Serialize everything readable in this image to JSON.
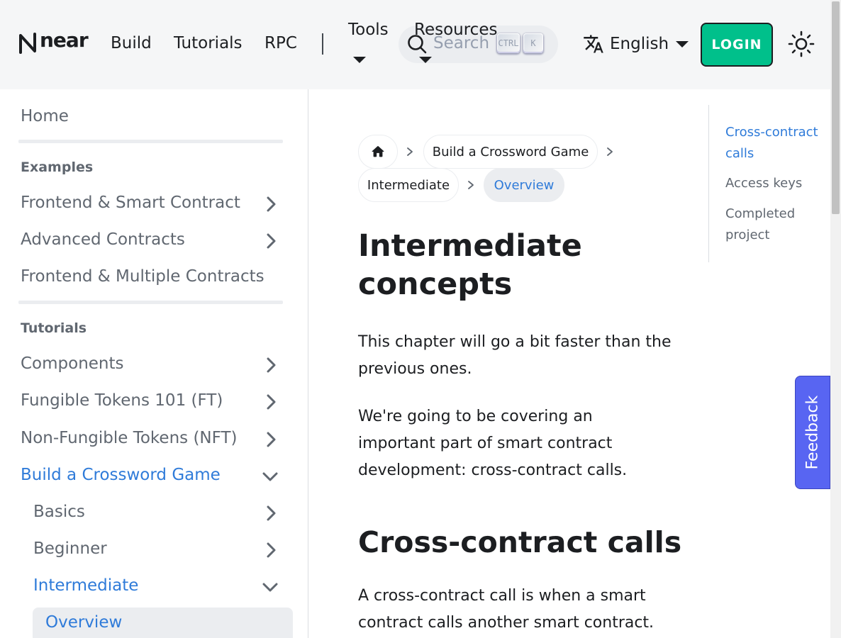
{
  "navbar": {
    "brand_text": "near",
    "links": {
      "build": "Build",
      "tutorials": "Tutorials",
      "rpc": "RPC",
      "tools": "Tools",
      "resources": "Resources"
    },
    "search": {
      "placeholder": "Search",
      "shortcut_keys": [
        "CTRL",
        "K"
      ]
    },
    "language": "English",
    "login_label": "LOGIN",
    "icons": {
      "brand": "near-logo-icon",
      "search": "search-icon",
      "language": "translate-icon",
      "theme": "sun-icon"
    }
  },
  "sidebar": {
    "home": "Home",
    "categories": {
      "examples": "Examples",
      "tutorials": "Tutorials"
    },
    "examples_items": [
      "Frontend & Smart Contract",
      "Advanced Contracts",
      "Frontend & Multiple Contracts"
    ],
    "tutorials_items": [
      "Components",
      "Fungible Tokens 101 (FT)",
      "Non-Fungible Tokens (NFT)",
      "Build a Crossword Game"
    ],
    "crossword_children": [
      "Basics",
      "Beginner",
      "Intermediate"
    ],
    "intermediate_children": [
      "Overview"
    ]
  },
  "breadcrumb": {
    "home_icon": "home-icon",
    "items": [
      "Build a Crossword Game",
      "Intermediate",
      "Overview"
    ]
  },
  "article": {
    "title": "Intermediate concepts",
    "paragraphs": [
      "This chapter will go a bit faster than the previous ones.",
      "We're going to be covering an important part of smart contract development: cross-contract calls."
    ],
    "section_title": "Cross-contract calls",
    "section_paragraph": "A cross-contract call is when a smart contract calls another smart contract."
  },
  "toc": {
    "items": [
      "Cross-contract calls",
      "Access keys",
      "Completed project"
    ],
    "active_index": 0
  },
  "feedback_label": "Feedback",
  "colors": {
    "accent": "#2f7bd9",
    "login_bg": "#00c08b",
    "feedback_bg": "#5865f2",
    "navbar_bg": "#f5f6f7"
  }
}
